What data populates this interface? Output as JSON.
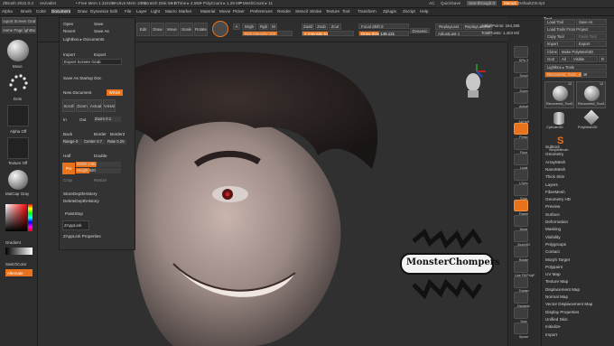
{
  "titlebar": {
    "app": "ZBrush 2022.0.4",
    "file": "revivalist",
    "free_mem": "• Free Mem 1.324GB",
    "active_mem": "• Active Mem 1002",
    "scratch": "• Scratch Disk 56.1",
    "rtime": "• RTime ▸ 4.592",
    "poly": "• PolyCount ▸ 1.28 MP",
    "mesh": "• MeshCount ▸ 11",
    "ac": "AC",
    "quicksave": "QuickSave",
    "seethrough": "See-through  0",
    "menus": "Menus",
    "default_script": "DefaultZScript"
  },
  "menubar": [
    "Alpha",
    "Brush",
    "Color",
    "Document",
    "Draw",
    "Dynamics",
    "Edit",
    "File",
    "Layer",
    "Light",
    "Macro",
    "Marker",
    "Material",
    "Movie",
    "Picker",
    "Preferences",
    "Render",
    "Stencil",
    "Stroke",
    "Texture",
    "Tool",
    "Transform",
    "Zplugin",
    "Zscript",
    "Help"
  ],
  "menubar_active": "Document",
  "left_shelf": {
    "screen_grab": "Export Screen Grab",
    "home_page": "Home Page",
    "lightbox": "LightBox",
    "move": "Move",
    "dots": "Dots",
    "alpha_off": "Alpha Off",
    "texture_off": "Texture Off",
    "matcap": "MatCap Gray",
    "gradient": "Gradient",
    "switch_color": "SwitchColor",
    "alternate": "Alternate"
  },
  "top_toolbar": {
    "edit": "Edit",
    "draw": "Draw",
    "move": "Move",
    "scale": "Scale",
    "rotate": "Rotate",
    "a": "A",
    "mrgb": "Mrgb",
    "rgb": "Rgb",
    "m": "M",
    "zadd": "Zadd",
    "zsub": "Zsub",
    "zcut": "Zcut",
    "rgb_intensity": "Rgb Intensity 100",
    "z_intensity": "Z Intensity 51",
    "focal_shift": "Focal Shift 0",
    "draw_size": "Draw Size 149.121",
    "dynamic": "Dynamic",
    "replay_last": "ReplayLast",
    "replay_last_rel": "ReplayLastRel",
    "adjust_last": "AdjustLast 1",
    "active_points": "ActivePoints: 164,306",
    "total_points": "TotalPoints: 1.403 Mil"
  },
  "document_menu": {
    "open": "Open",
    "save": "Save",
    "revert": "Revert",
    "save_as": "Save As",
    "lightbox_documents": "Lightbox ▸ Documents",
    "import": "Import",
    "export": "Export",
    "export_screen_grab": "Export Screen Grab",
    "save_as_startup": "Save As Startup Doc",
    "new_document": "New Document",
    "wsize": "WSize",
    "scroll": "Scroll",
    "zoom": "Zoom",
    "actual": "Actual",
    "aahalf": "AAHalf",
    "in": "In",
    "out": "Out",
    "zoom_val": "Zoom 0.1",
    "back": "Back",
    "border": "Border",
    "border2": "Border2",
    "range": "Range 0",
    "center": "Center 0.7",
    "rate": "Rate 0.25",
    "half": "Half",
    "double": "Double",
    "pro": "Pro",
    "width": "Width 1482",
    "height": "Height 920",
    "crop": "Crop",
    "resize": "Resize",
    "store_depth": "StoreDepthHistory",
    "delete_depth": "DeleteDepthHistory",
    "paintstop": "PaintStop",
    "zapplink": "ZAppLink",
    "zapplink_props": "ZAppLink Properties"
  },
  "right_shelf": [
    "SPix 3",
    "Scroll",
    "Zoom",
    "Actual",
    "AAHalf",
    "Persp",
    "Floor",
    "Local",
    "LSym",
    "Gxyz",
    "Frame",
    "Move",
    "Zoom3D",
    "Rotate",
    "Line Fill PolyF",
    "Transp",
    "Dynamic",
    "Solo",
    "Xpose"
  ],
  "tool_panel": {
    "load_tool": "Load Tool",
    "save_as": "Save As",
    "load_from_project": "Load Tools From Project",
    "copy_tool": "Copy Tool",
    "paste_tool": "Paste Tool",
    "import": "Import",
    "export": "Export",
    "clone": "Clone",
    "make_polymesh": "Make PolyMesh3D",
    "goz": "GoZ",
    "all": "All",
    "visible": "Visible",
    "r": "R",
    "lightbox_tools": "Lightbox ▸ Tools",
    "current_tool": "Recovered_Tool1_0. 49",
    "thumbs": [
      "Recovered_Tool1",
      "Recovered_Tool1",
      "Cylinder3D",
      "PolyMesh3D",
      "SimpleBrush"
    ],
    "thumb_counts": [
      "12",
      "12"
    ],
    "subtools": [
      "Subtool",
      "Geometry",
      "ArrayMesh",
      "NanoMesh",
      "Thick Skin",
      "Layers",
      "FiberMesh",
      "Geometry HD",
      "Preview",
      "Surface",
      "Deformation",
      "Masking",
      "Visibility",
      "Polygroups",
      "Contact",
      "Morph Target",
      "Polypaint",
      "UV Map",
      "Texture Map",
      "Displacement Map",
      "Normal Map",
      "Vector Displacement Map",
      "Display Properties",
      "Unified Skin",
      "Initialize",
      "Import"
    ]
  },
  "watermark": "MonsterChompers",
  "colors": {
    "accent": "#e8731c",
    "panel": "#2e2e2e",
    "background": "#303030"
  }
}
